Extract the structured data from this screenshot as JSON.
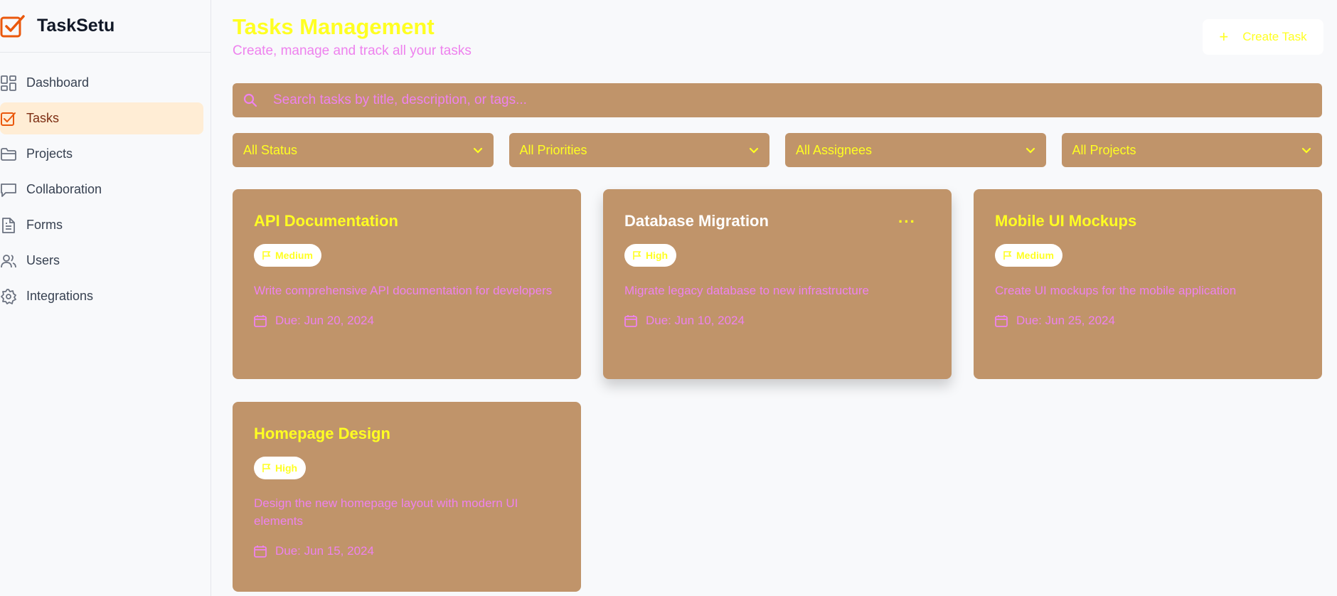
{
  "app": {
    "name": "TaskSetu"
  },
  "sidebar": {
    "items": [
      {
        "label": "Dashboard",
        "icon": "dashboard-icon",
        "active": false
      },
      {
        "label": "Tasks",
        "icon": "tasks-icon",
        "active": true
      },
      {
        "label": "Projects",
        "icon": "folder-icon",
        "active": false
      },
      {
        "label": "Collaboration",
        "icon": "chat-icon",
        "active": false
      },
      {
        "label": "Forms",
        "icon": "document-icon",
        "active": false
      },
      {
        "label": "Users",
        "icon": "users-icon",
        "active": false
      },
      {
        "label": "Integrations",
        "icon": "gear-icon",
        "active": false
      }
    ]
  },
  "header": {
    "title": "Tasks Management",
    "subtitle": "Create, manage and track all your tasks",
    "create_label": "Create Task"
  },
  "search": {
    "placeholder": "Search tasks by title, description, or tags..."
  },
  "filters": [
    "All Status",
    "All Priorities",
    "All Assignees",
    "All Projects"
  ],
  "tasks": [
    {
      "title": "API Documentation",
      "priority": "Medium",
      "description": "Write comprehensive API documentation for developers",
      "due": "Due: Jun 20, 2024"
    },
    {
      "title": "Database Migration",
      "priority": "High",
      "description": "Migrate legacy database to new infrastructure",
      "due": "Due: Jun 10, 2024",
      "menu": "···"
    },
    {
      "title": "Mobile UI Mockups",
      "priority": "Medium",
      "description": "Create UI mockups for the mobile application",
      "due": "Due: Jun 25, 2024"
    },
    {
      "title": "Homepage Design",
      "priority": "High",
      "description": "Design the new homepage layout with modern UI elements",
      "due": "Due: Jun 15, 2024"
    }
  ],
  "colors": {
    "accent": "#ea580c",
    "card_bg": "#c0946a",
    "title_yellow": "#ffff22",
    "text_pink": "#ee82ee",
    "active_nav_bg": "#ffedd5"
  }
}
